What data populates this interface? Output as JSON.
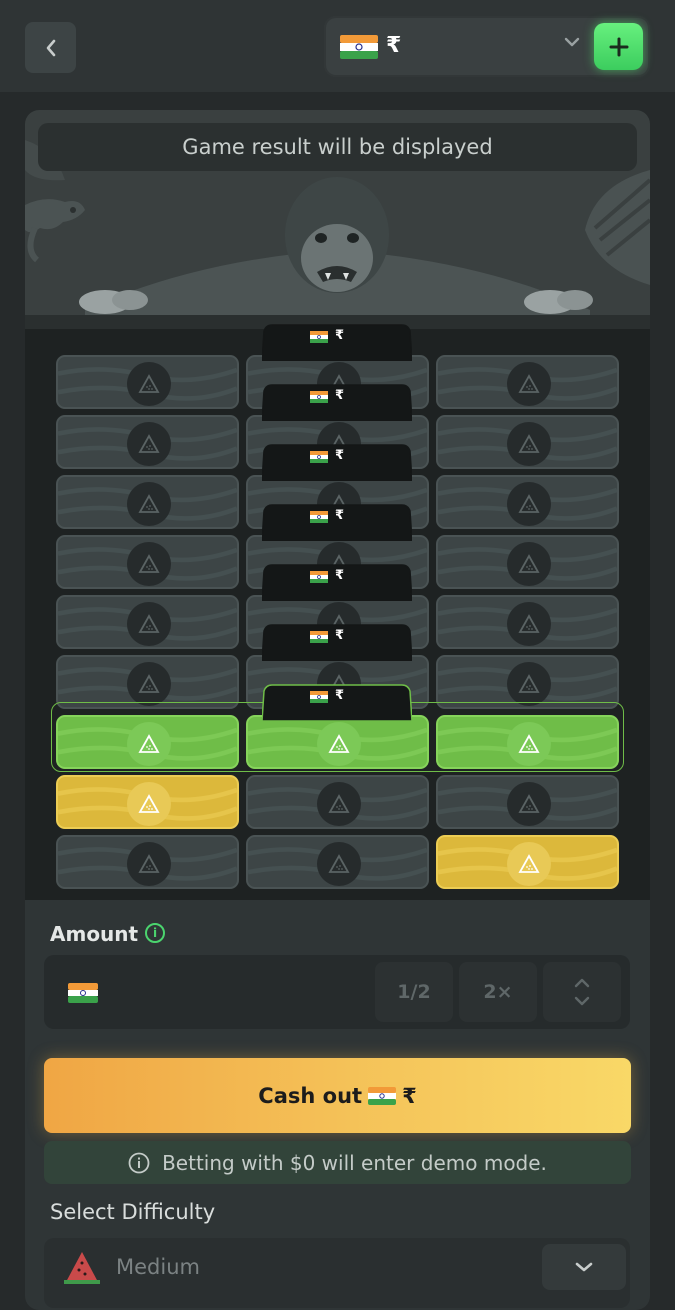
{
  "header": {
    "back_icon": "chevron-left-icon",
    "balance_currency": "₹",
    "balance_flag": "india-flag-icon",
    "dropdown_icon": "chevron-down-icon",
    "add_icon": "plus-icon"
  },
  "game": {
    "result_text": "Game result will be displayed",
    "bet_tag_currency": "₹",
    "grid_rows": [
      [
        "default",
        "default",
        "default"
      ],
      [
        "default",
        "default",
        "default"
      ],
      [
        "default",
        "default",
        "default"
      ],
      [
        "default",
        "default",
        "default"
      ],
      [
        "default",
        "default",
        "default"
      ],
      [
        "default",
        "default",
        "default"
      ],
      [
        "green",
        "green",
        "green"
      ],
      [
        "gold",
        "default",
        "default"
      ],
      [
        "default",
        "default",
        "gold"
      ]
    ]
  },
  "amount": {
    "label": "Amount",
    "half_label": "1/2",
    "double_label": "2×"
  },
  "cashout": {
    "label": "Cash out",
    "currency": "₹"
  },
  "demo_note": "Betting with $0 will enter demo mode.",
  "difficulty": {
    "label": "Select Difficulty",
    "value": "Medium"
  },
  "colors": {
    "accent_green": "#4bd46e",
    "cashout_orange": "#f0a644",
    "cashout_yellow": "#f9d867",
    "tile_green": "#6fbd48",
    "tile_gold": "#dcb83b"
  }
}
